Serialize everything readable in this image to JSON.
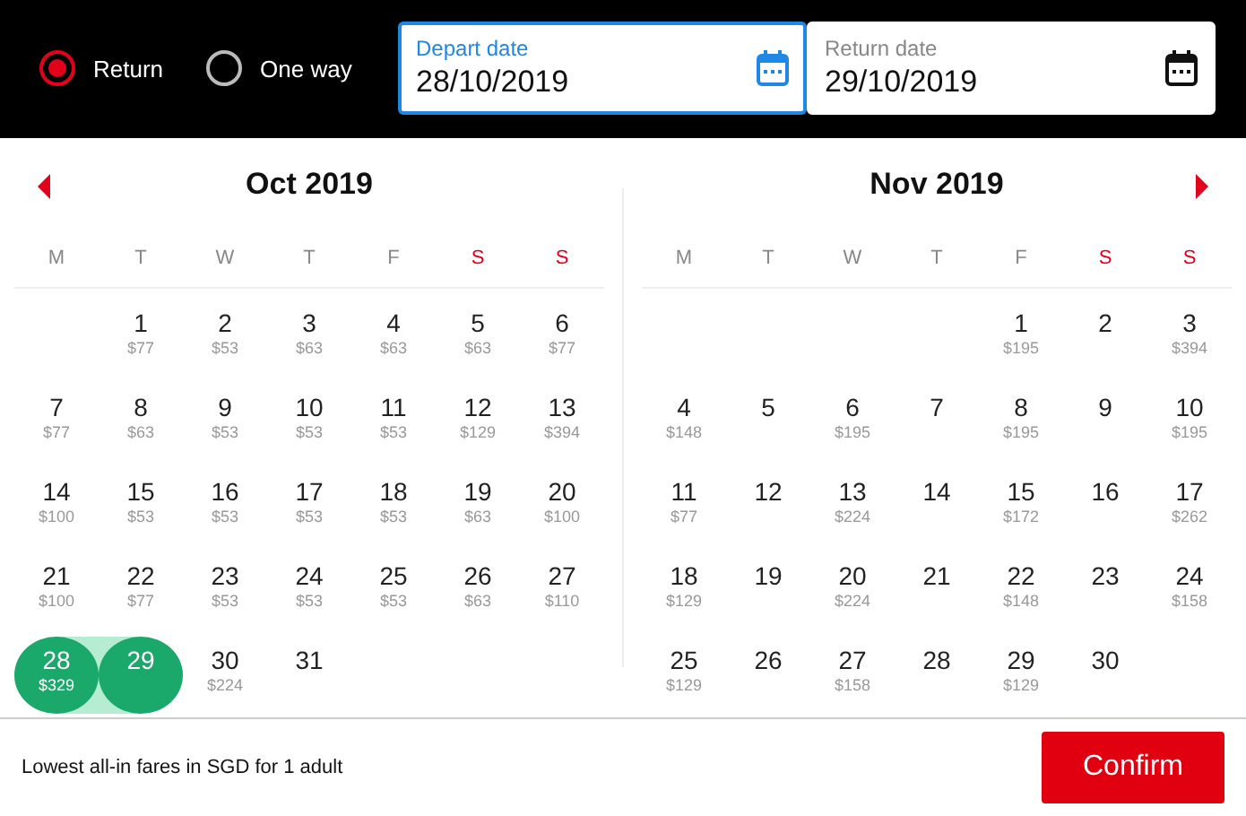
{
  "trip_type": [
    {
      "label": "Return",
      "selected": true
    },
    {
      "label": "One way",
      "selected": false
    }
  ],
  "fields": [
    {
      "label": "Depart date",
      "value": "28/10/2019",
      "focused": true
    },
    {
      "label": "Return date",
      "value": "29/10/2019",
      "focused": false
    }
  ],
  "months": [
    {
      "title": "Oct 2019",
      "prev_button": true,
      "next_button": false,
      "weekdays": [
        {
          "label": "M",
          "weekend": false
        },
        {
          "label": "T",
          "weekend": false
        },
        {
          "label": "W",
          "weekend": false
        },
        {
          "label": "T",
          "weekend": false
        },
        {
          "label": "F",
          "weekend": false
        },
        {
          "label": "S",
          "weekend": true
        },
        {
          "label": "S",
          "weekend": true
        }
      ],
      "weeks": [
        [
          {
            "kind": "blank"
          },
          {
            "kind": "day",
            "day": "1",
            "price": "$77",
            "selected": false
          },
          {
            "kind": "day",
            "day": "2",
            "price": "$53",
            "selected": false
          },
          {
            "kind": "day",
            "day": "3",
            "price": "$63",
            "selected": false
          },
          {
            "kind": "day",
            "day": "4",
            "price": "$63",
            "selected": false
          },
          {
            "kind": "day",
            "day": "5",
            "price": "$63",
            "selected": false
          },
          {
            "kind": "day",
            "day": "6",
            "price": "$77",
            "selected": false
          }
        ],
        [
          {
            "kind": "day",
            "day": "7",
            "price": "$77",
            "selected": false
          },
          {
            "kind": "day",
            "day": "8",
            "price": "$63",
            "selected": false
          },
          {
            "kind": "day",
            "day": "9",
            "price": "$53",
            "selected": false
          },
          {
            "kind": "day",
            "day": "10",
            "price": "$53",
            "selected": false
          },
          {
            "kind": "day",
            "day": "11",
            "price": "$53",
            "selected": false
          },
          {
            "kind": "day",
            "day": "12",
            "price": "$129",
            "selected": false
          },
          {
            "kind": "day",
            "day": "13",
            "price": "$394",
            "selected": false
          }
        ],
        [
          {
            "kind": "day",
            "day": "14",
            "price": "$100",
            "selected": false
          },
          {
            "kind": "day",
            "day": "15",
            "price": "$53",
            "selected": false
          },
          {
            "kind": "day",
            "day": "16",
            "price": "$53",
            "selected": false
          },
          {
            "kind": "day",
            "day": "17",
            "price": "$53",
            "selected": false
          },
          {
            "kind": "day",
            "day": "18",
            "price": "$53",
            "selected": false
          },
          {
            "kind": "day",
            "day": "19",
            "price": "$63",
            "selected": false
          },
          {
            "kind": "day",
            "day": "20",
            "price": "$100",
            "selected": false
          }
        ],
        [
          {
            "kind": "day",
            "day": "21",
            "price": "$100",
            "selected": false
          },
          {
            "kind": "day",
            "day": "22",
            "price": "$77",
            "selected": false
          },
          {
            "kind": "day",
            "day": "23",
            "price": "$53",
            "selected": false
          },
          {
            "kind": "day",
            "day": "24",
            "price": "$53",
            "selected": false
          },
          {
            "kind": "day",
            "day": "25",
            "price": "$53",
            "selected": false
          },
          {
            "kind": "day",
            "day": "26",
            "price": "$63",
            "selected": false
          },
          {
            "kind": "day",
            "day": "27",
            "price": "$110",
            "selected": false
          }
        ],
        [
          {
            "kind": "day",
            "day": "28",
            "price": "$329",
            "selected": true
          },
          {
            "kind": "day",
            "day": "29",
            "selected": true
          },
          {
            "kind": "day",
            "day": "30",
            "price": "$224",
            "selected": false
          },
          {
            "kind": "day",
            "day": "31",
            "selected": false
          },
          {
            "kind": "blank"
          },
          {
            "kind": "blank"
          },
          {
            "kind": "blank"
          }
        ]
      ]
    },
    {
      "title": "Nov 2019",
      "prev_button": false,
      "next_button": true,
      "weekdays": [
        {
          "label": "M",
          "weekend": false
        },
        {
          "label": "T",
          "weekend": false
        },
        {
          "label": "W",
          "weekend": false
        },
        {
          "label": "T",
          "weekend": false
        },
        {
          "label": "F",
          "weekend": false
        },
        {
          "label": "S",
          "weekend": true
        },
        {
          "label": "S",
          "weekend": true
        }
      ],
      "weeks": [
        [
          {
            "kind": "blank"
          },
          {
            "kind": "blank"
          },
          {
            "kind": "blank"
          },
          {
            "kind": "blank"
          },
          {
            "kind": "day",
            "day": "1",
            "price": "$195",
            "selected": false
          },
          {
            "kind": "day",
            "day": "2",
            "selected": false
          },
          {
            "kind": "day",
            "day": "3",
            "price": "$394",
            "selected": false
          }
        ],
        [
          {
            "kind": "day",
            "day": "4",
            "price": "$148",
            "selected": false
          },
          {
            "kind": "day",
            "day": "5",
            "selected": false
          },
          {
            "kind": "day",
            "day": "6",
            "price": "$195",
            "selected": false
          },
          {
            "kind": "day",
            "day": "7",
            "selected": false
          },
          {
            "kind": "day",
            "day": "8",
            "price": "$195",
            "selected": false
          },
          {
            "kind": "day",
            "day": "9",
            "selected": false
          },
          {
            "kind": "day",
            "day": "10",
            "price": "$195",
            "selected": false
          }
        ],
        [
          {
            "kind": "day",
            "day": "11",
            "price": "$77",
            "selected": false
          },
          {
            "kind": "day",
            "day": "12",
            "selected": false
          },
          {
            "kind": "day",
            "day": "13",
            "price": "$224",
            "selected": false
          },
          {
            "kind": "day",
            "day": "14",
            "selected": false
          },
          {
            "kind": "day",
            "day": "15",
            "price": "$172",
            "selected": false
          },
          {
            "kind": "day",
            "day": "16",
            "selected": false
          },
          {
            "kind": "day",
            "day": "17",
            "price": "$262",
            "selected": false
          }
        ],
        [
          {
            "kind": "day",
            "day": "18",
            "price": "$129",
            "selected": false
          },
          {
            "kind": "day",
            "day": "19",
            "selected": false
          },
          {
            "kind": "day",
            "day": "20",
            "price": "$224",
            "selected": false
          },
          {
            "kind": "day",
            "day": "21",
            "selected": false
          },
          {
            "kind": "day",
            "day": "22",
            "price": "$148",
            "selected": false
          },
          {
            "kind": "day",
            "day": "23",
            "selected": false
          },
          {
            "kind": "day",
            "day": "24",
            "price": "$158",
            "selected": false
          }
        ],
        [
          {
            "kind": "day",
            "day": "25",
            "price": "$129",
            "selected": false
          },
          {
            "kind": "day",
            "day": "26",
            "selected": false
          },
          {
            "kind": "day",
            "day": "27",
            "price": "$158",
            "selected": false
          },
          {
            "kind": "day",
            "day": "28",
            "selected": false
          },
          {
            "kind": "day",
            "day": "29",
            "price": "$129",
            "selected": false
          },
          {
            "kind": "day",
            "day": "30",
            "selected": false
          },
          {
            "kind": "blank"
          }
        ]
      ]
    }
  ],
  "footer": {
    "note": "Lowest all-in fares in SGD for 1 adult",
    "button": "Confirm"
  }
}
